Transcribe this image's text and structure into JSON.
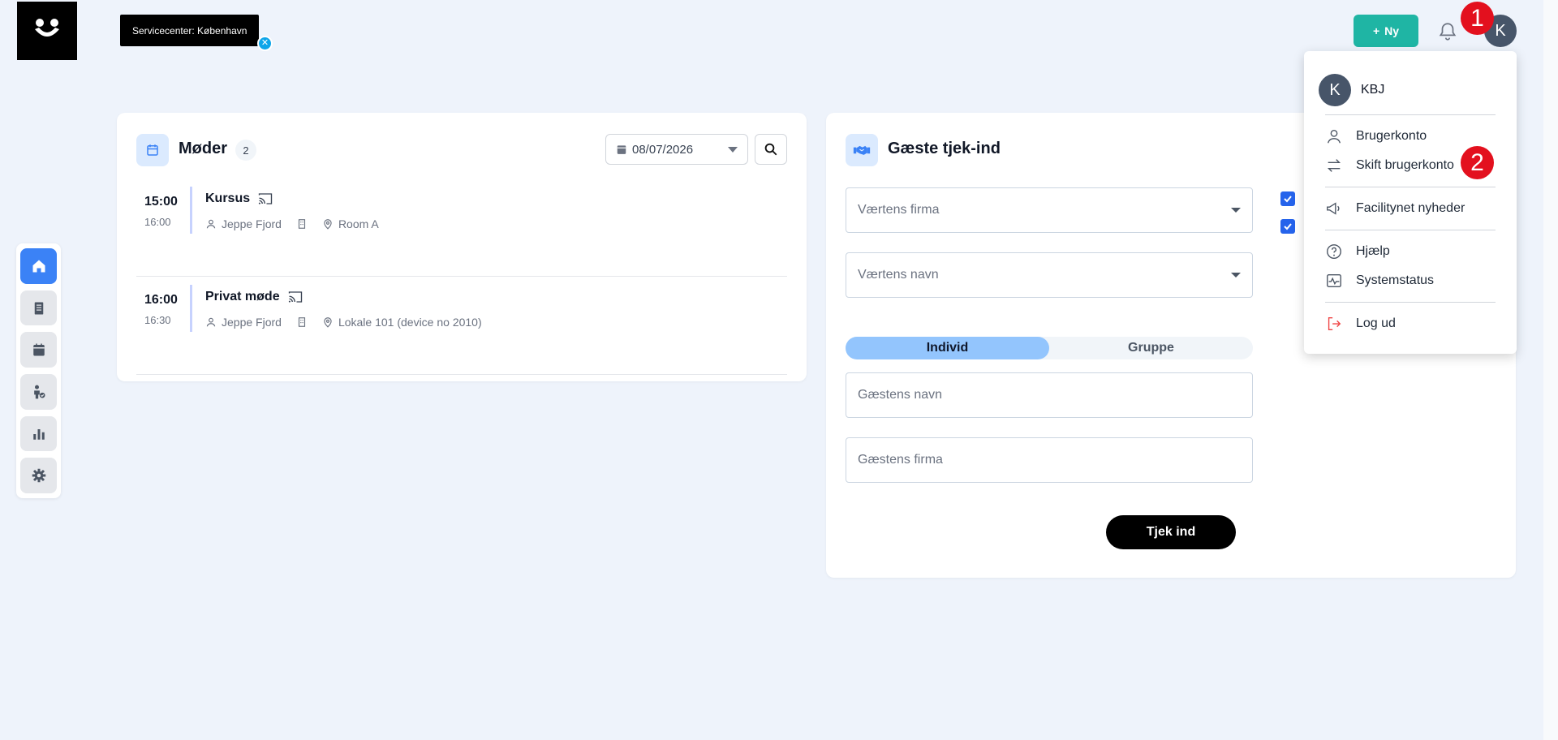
{
  "header": {
    "servicecenter_label": "Servicecenter: København",
    "new_button_label": "Ny",
    "user_initial": "K"
  },
  "markers": [
    "1",
    "2"
  ],
  "meetings_card": {
    "title": "Møder",
    "count": "2",
    "date": "08/07/2026",
    "items": [
      {
        "start": "15:00",
        "end": "16:00",
        "title": "Kursus",
        "organizer": "Jeppe Fjord",
        "room": "Room A"
      },
      {
        "start": "16:00",
        "end": "16:30",
        "title": "Privat møde",
        "organizer": "Jeppe Fjord",
        "room": "Lokale 101 (device no 2010)"
      }
    ]
  },
  "guest_card": {
    "title": "Gæste tjek-ind",
    "host_company_placeholder": "Værtens firma",
    "host_name_placeholder": "Værtens navn",
    "mode_individual": "Individ",
    "mode_group": "Gruppe",
    "guest_name_placeholder": "Gæstens navn",
    "guest_company_placeholder": "Gæstens firma",
    "checkin_button": "Tjek ind"
  },
  "user_menu": {
    "initial": "K",
    "username": "KBJ",
    "items": {
      "account": "Brugerkonto",
      "switch": "Skift brugerkonto",
      "news": "Facilitynet nyheder",
      "help": "Hjælp",
      "status": "Systemstatus",
      "logout": "Log ud"
    }
  },
  "colors": {
    "accent_teal": "#1fb5a4",
    "primary_blue": "#3b82f6",
    "marker_red": "#e3101e",
    "background": "#eef3fb"
  }
}
